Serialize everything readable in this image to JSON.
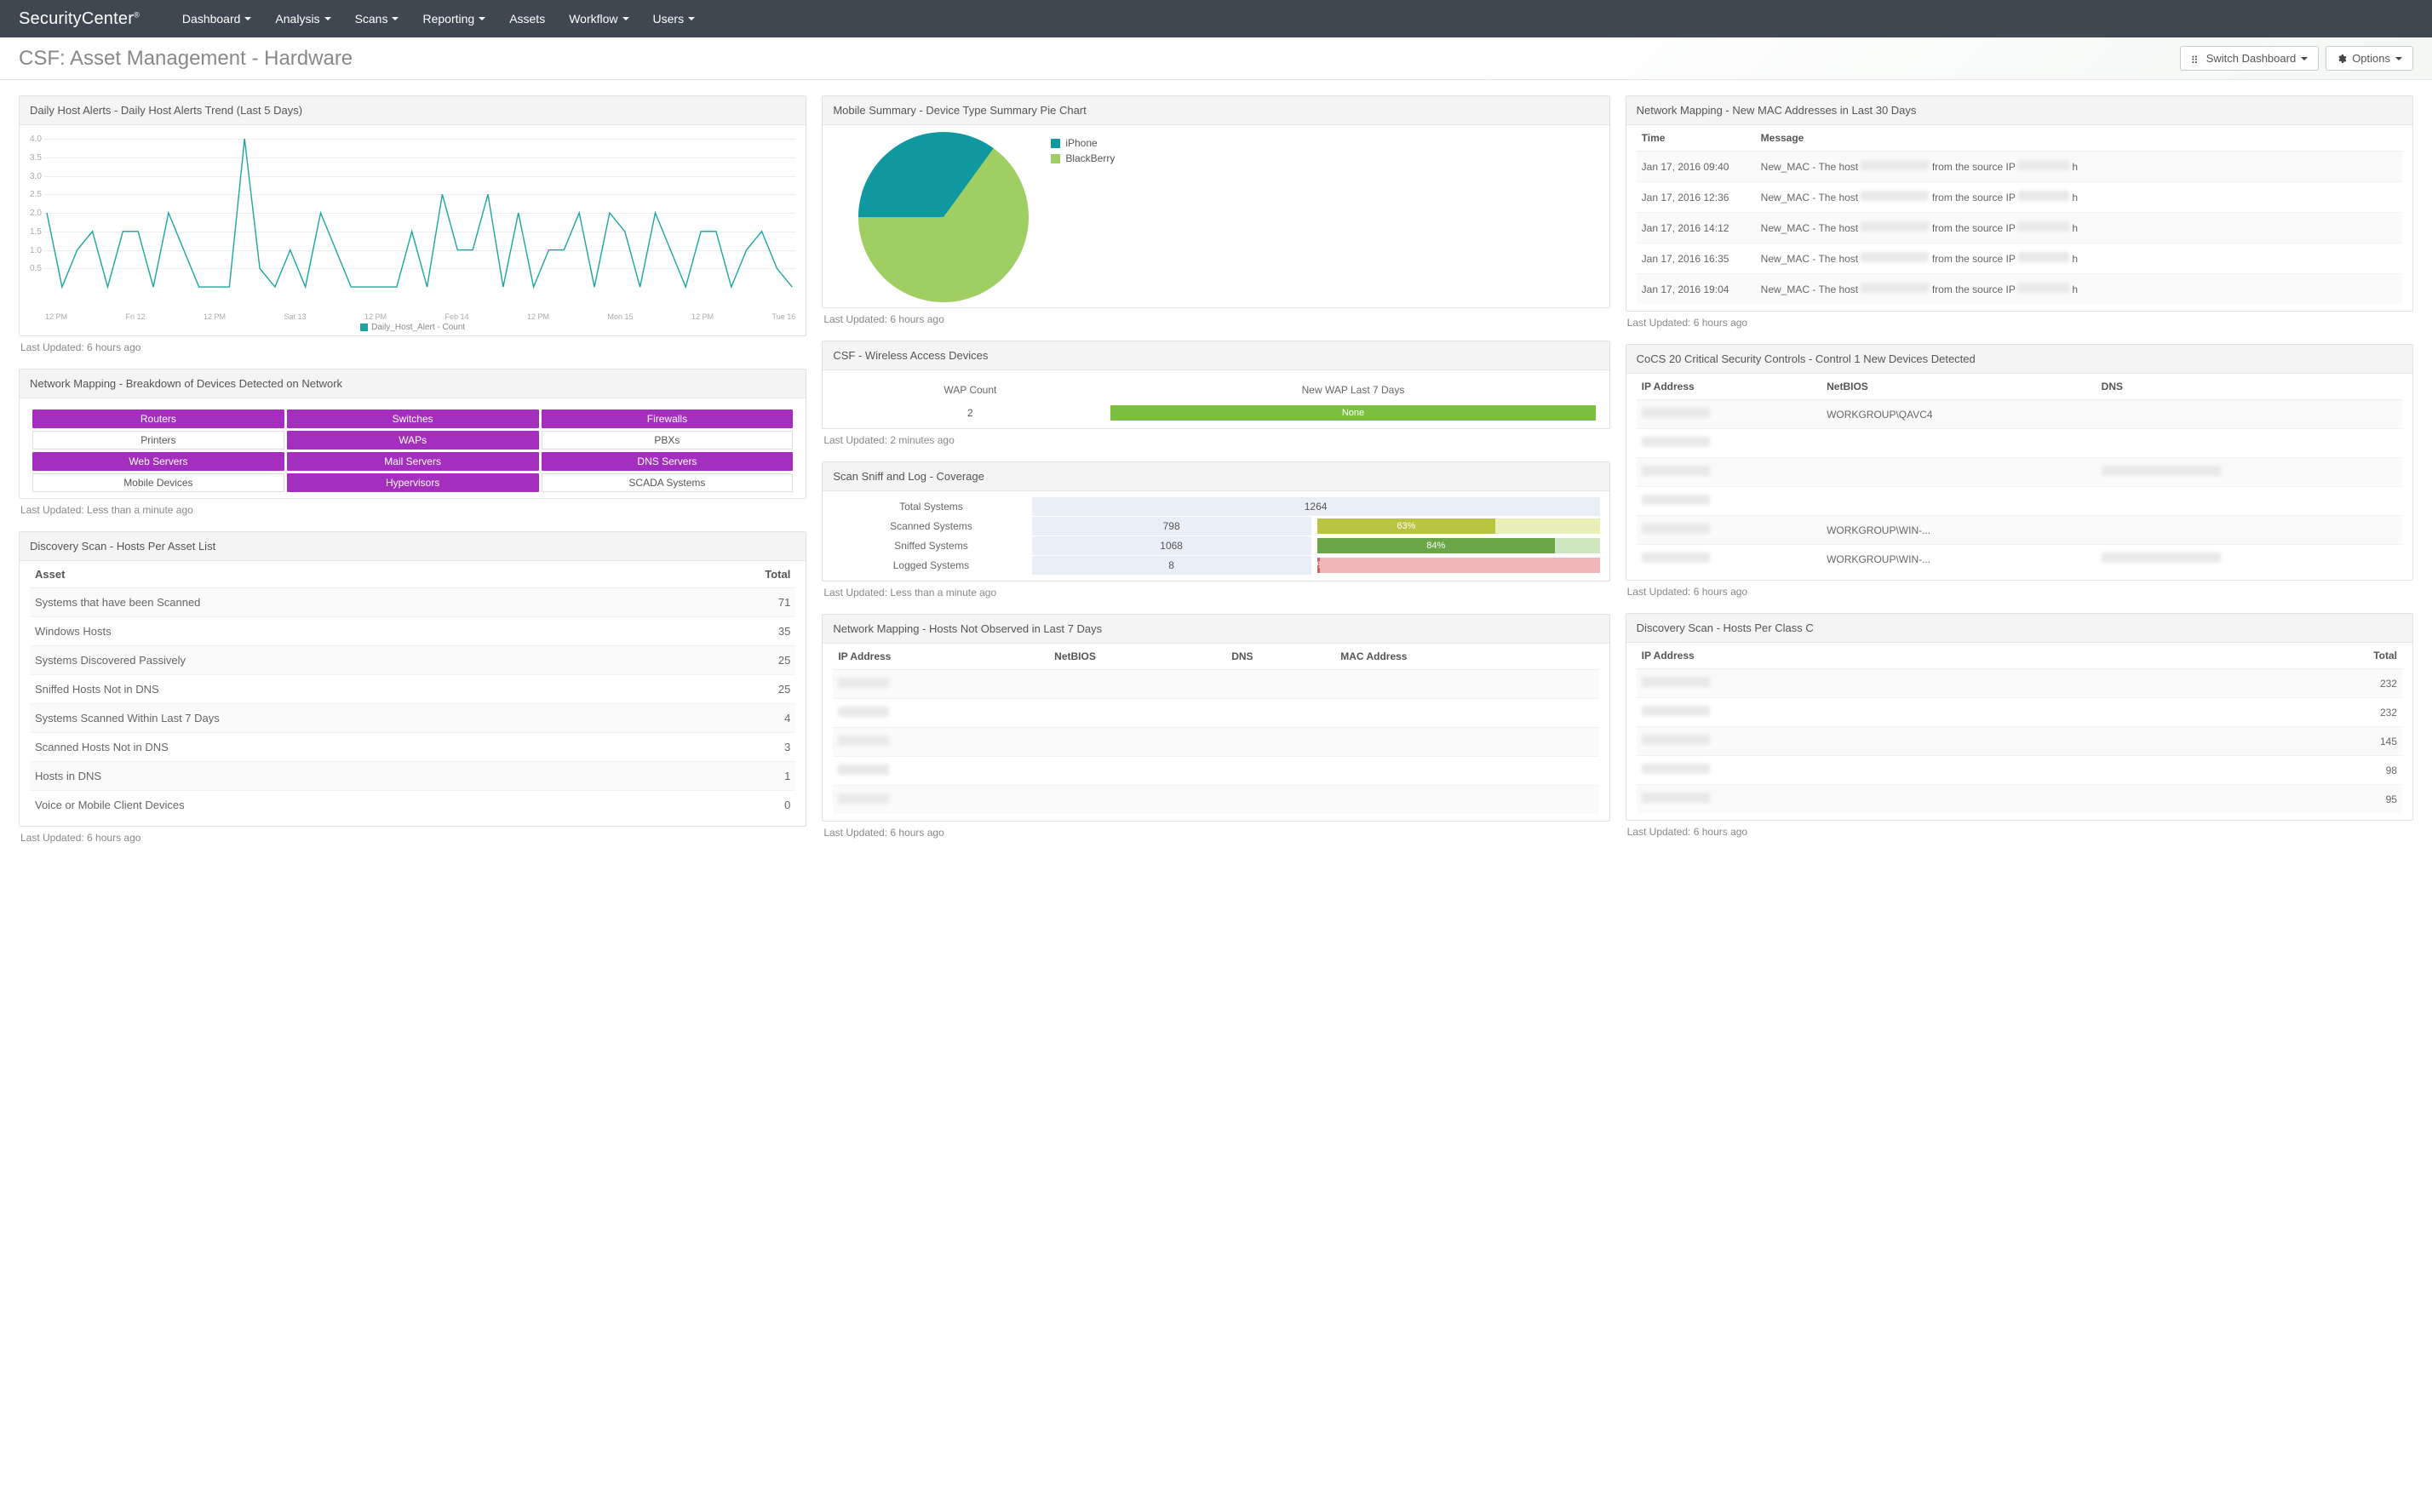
{
  "brand": "SecurityCenter",
  "nav": [
    "Dashboard",
    "Analysis",
    "Scans",
    "Reporting",
    "Assets",
    "Workflow",
    "Users"
  ],
  "nav_static": [
    4
  ],
  "page_title": "CSF: Asset Management - Hardware",
  "buttons": {
    "switch": "Switch Dashboard",
    "options": "Options"
  },
  "updated": {
    "six_hours": "Last Updated: 6 hours ago",
    "lt_min": "Last Updated: Less than a minute ago",
    "two_min": "Last Updated: 2 minutes ago"
  },
  "panels": {
    "alerts_title": "Daily Host Alerts - Daily Host Alerts Trend (Last 5 Days)",
    "devices_title": "Network Mapping - Breakdown of Devices Detected on Network",
    "assetlist_title": "Discovery Scan - Hosts Per Asset List",
    "pie_title": "Mobile Summary - Device Type Summary Pie Chart",
    "wireless_title": "CSF - Wireless Access Devices",
    "coverage_title": "Scan Sniff and Log - Coverage",
    "notobserved_title": "Network Mapping - Hosts Not Observed in Last 7 Days",
    "mac_title": "Network Mapping - New MAC Addresses in Last 30 Days",
    "cocs_title": "CoCS 20 Critical Security Controls - Control 1 New Devices Detected",
    "classc_title": "Discovery Scan - Hosts Per Class C"
  },
  "chart_data": {
    "type": "line",
    "title": "Daily Host Alerts - Daily Host Alerts Trend (Last 5 Days)",
    "legend": "Daily_Host_Alert - Count",
    "y_ticks": [
      0.5,
      1.0,
      1.5,
      2.0,
      2.5,
      3.0,
      3.5,
      4.0
    ],
    "ylim": [
      0,
      4.0
    ],
    "x_ticks": [
      "12 PM",
      "Fri 12",
      "12 PM",
      "Sat 13",
      "12 PM",
      "Feb 14",
      "12 PM",
      "Mon 15",
      "12 PM",
      "Tue 16"
    ],
    "values": [
      2.0,
      0,
      1.0,
      1.5,
      0,
      1.5,
      1.5,
      0,
      2.0,
      1.0,
      0,
      0,
      0,
      4.0,
      0.5,
      0,
      1.0,
      0,
      2.0,
      1.0,
      0,
      0,
      0,
      0,
      1.5,
      0,
      2.5,
      1.0,
      1.0,
      2.5,
      0,
      2.0,
      0,
      1.0,
      1.0,
      2.0,
      0,
      2.0,
      1.5,
      0,
      2.0,
      1.0,
      0,
      1.5,
      1.5,
      0,
      1.0,
      1.5,
      0.5,
      0
    ]
  },
  "device_matrix": [
    [
      {
        "label": "Routers",
        "hot": true
      },
      {
        "label": "Switches",
        "hot": true
      },
      {
        "label": "Firewalls",
        "hot": true
      }
    ],
    [
      {
        "label": "Printers",
        "hot": false
      },
      {
        "label": "WAPs",
        "hot": true
      },
      {
        "label": "PBXs",
        "hot": false
      }
    ],
    [
      {
        "label": "Web Servers",
        "hot": true
      },
      {
        "label": "Mail Servers",
        "hot": true
      },
      {
        "label": "DNS Servers",
        "hot": true
      }
    ],
    [
      {
        "label": "Mobile Devices",
        "hot": false
      },
      {
        "label": "Hypervisors",
        "hot": true
      },
      {
        "label": "SCADA Systems",
        "hot": false
      }
    ]
  ],
  "asset_list": {
    "headers": [
      "Asset",
      "Total"
    ],
    "rows": [
      {
        "name": "Systems that have been Scanned",
        "total": 71
      },
      {
        "name": "Windows Hosts",
        "total": 35
      },
      {
        "name": "Systems Discovered Passively",
        "total": 25
      },
      {
        "name": "Sniffed Hosts Not in DNS",
        "total": 25
      },
      {
        "name": "Systems Scanned Within Last 7 Days",
        "total": 4
      },
      {
        "name": "Scanned Hosts Not in DNS",
        "total": 3
      },
      {
        "name": "Hosts in DNS",
        "total": 1
      },
      {
        "name": "Voice or Mobile Client Devices",
        "total": 0
      }
    ]
  },
  "pie": {
    "type": "pie",
    "series": [
      {
        "name": "iPhone",
        "value": 35,
        "color": "#1098a0"
      },
      {
        "name": "BlackBerry",
        "value": 65,
        "color": "#9fcf63"
      }
    ]
  },
  "wireless": {
    "headers": [
      "WAP Count",
      "New WAP Last 7 Days"
    ],
    "count": 2,
    "new_label": "None"
  },
  "coverage": {
    "total_label": "Total Systems",
    "rows": [
      {
        "label": "Scanned Systems",
        "count": 798,
        "pct": 63,
        "fill": "#b9c53f",
        "rest": "#e9efb6"
      },
      {
        "label": "Sniffed Systems",
        "count": 1068,
        "pct": 84,
        "fill": "#6aa546",
        "rest": "#cfe6c0"
      },
      {
        "label": "Logged Systems",
        "count": 8,
        "pct": 1,
        "fill": "#d26060",
        "rest": "#efb7b7"
      }
    ],
    "total": 1264
  },
  "not_observed": {
    "headers": [
      "IP Address",
      "NetBIOS",
      "DNS",
      "MAC Address"
    ],
    "row_count": 5
  },
  "mac_log": {
    "headers": [
      "Time",
      "Message"
    ],
    "rows": [
      {
        "time": "Jan 17, 2016 09:40",
        "prefix": "New_MAC - The host",
        "mid": "from the source IP",
        "suffix": "h"
      },
      {
        "time": "Jan 17, 2016 12:36",
        "prefix": "New_MAC - The host",
        "mid": "from the source IP",
        "suffix": "h"
      },
      {
        "time": "Jan 17, 2016 14:12",
        "prefix": "New_MAC - The host",
        "mid": "from the source IP",
        "suffix": "h"
      },
      {
        "time": "Jan 17, 2016 16:35",
        "prefix": "New_MAC - The host",
        "mid": "from the source IP",
        "suffix": "h"
      },
      {
        "time": "Jan 17, 2016 19:04",
        "prefix": "New_MAC - The host",
        "mid": "from the source IP",
        "suffix": "h"
      }
    ]
  },
  "cocs": {
    "headers": [
      "IP Address",
      "NetBIOS",
      "DNS"
    ],
    "rows": [
      {
        "netbios": "WORKGROUP\\QAVC4",
        "dns": ""
      },
      {
        "netbios": "",
        "dns": ""
      },
      {
        "netbios": "",
        "dns": "blur"
      },
      {
        "netbios": "",
        "dns": ""
      },
      {
        "netbios": "WORKGROUP\\WIN-...",
        "dns": ""
      },
      {
        "netbios": "WORKGROUP\\WIN-...",
        "dns": "blur"
      }
    ]
  },
  "classc": {
    "headers": [
      "IP Address",
      "Total"
    ],
    "rows": [
      {
        "total": 232
      },
      {
        "total": 232
      },
      {
        "total": 145
      },
      {
        "total": 98
      },
      {
        "total": 95
      }
    ]
  }
}
